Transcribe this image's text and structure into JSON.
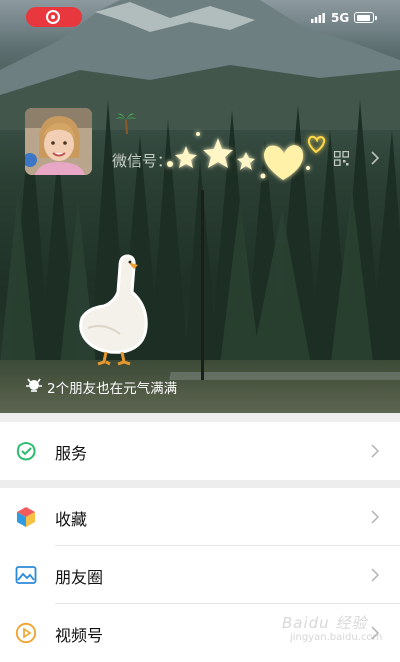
{
  "status_bar": {
    "network": "5G",
    "icons": [
      "screen-record-icon",
      "signal-icon",
      "battery-icon"
    ]
  },
  "profile": {
    "wechat_id_label": "微信号：",
    "friends_status": "2个朋友也在元气满满",
    "icons": [
      "avatar",
      "palm-tree-icon",
      "sparkle-stars-heart-icon",
      "qr-code-icon",
      "chevron-right-icon",
      "goose-sticker",
      "status-icon"
    ]
  },
  "menu": {
    "services": {
      "label": "服务",
      "icon": "services-icon"
    },
    "favorites": {
      "label": "收藏",
      "icon": "favorites-cube-icon"
    },
    "moments": {
      "label": "朋友圈",
      "icon": "moments-image-icon"
    },
    "channels": {
      "label": "视频号",
      "icon": "channels-play-icon"
    }
  },
  "watermark": {
    "text": "Baidu 经验",
    "sub": "jingyan.baidu.com"
  },
  "colors": {
    "record_red": "#e8373d",
    "services_green": "#2dbd72",
    "moments_blue": "#2a8ad6",
    "channels_orange": "#f0a22c",
    "page_bg": "#ededed"
  }
}
